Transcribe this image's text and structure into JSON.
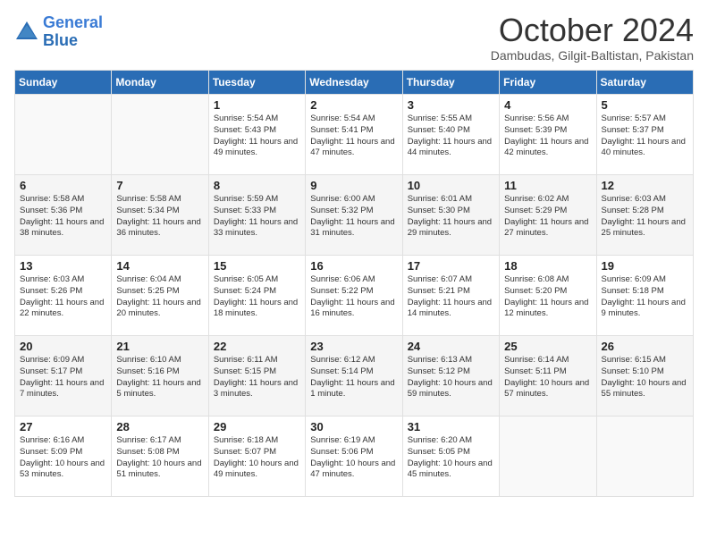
{
  "logo": {
    "line1": "General",
    "line2": "Blue"
  },
  "title": "October 2024",
  "location": "Dambudas, Gilgit-Baltistan, Pakistan",
  "days_of_week": [
    "Sunday",
    "Monday",
    "Tuesday",
    "Wednesday",
    "Thursday",
    "Friday",
    "Saturday"
  ],
  "weeks": [
    [
      {
        "day": null,
        "text": null
      },
      {
        "day": null,
        "text": null
      },
      {
        "day": "1",
        "text": "Sunrise: 5:54 AM\nSunset: 5:43 PM\nDaylight: 11 hours and 49 minutes."
      },
      {
        "day": "2",
        "text": "Sunrise: 5:54 AM\nSunset: 5:41 PM\nDaylight: 11 hours and 47 minutes."
      },
      {
        "day": "3",
        "text": "Sunrise: 5:55 AM\nSunset: 5:40 PM\nDaylight: 11 hours and 44 minutes."
      },
      {
        "day": "4",
        "text": "Sunrise: 5:56 AM\nSunset: 5:39 PM\nDaylight: 11 hours and 42 minutes."
      },
      {
        "day": "5",
        "text": "Sunrise: 5:57 AM\nSunset: 5:37 PM\nDaylight: 11 hours and 40 minutes."
      }
    ],
    [
      {
        "day": "6",
        "text": "Sunrise: 5:58 AM\nSunset: 5:36 PM\nDaylight: 11 hours and 38 minutes."
      },
      {
        "day": "7",
        "text": "Sunrise: 5:58 AM\nSunset: 5:34 PM\nDaylight: 11 hours and 36 minutes."
      },
      {
        "day": "8",
        "text": "Sunrise: 5:59 AM\nSunset: 5:33 PM\nDaylight: 11 hours and 33 minutes."
      },
      {
        "day": "9",
        "text": "Sunrise: 6:00 AM\nSunset: 5:32 PM\nDaylight: 11 hours and 31 minutes."
      },
      {
        "day": "10",
        "text": "Sunrise: 6:01 AM\nSunset: 5:30 PM\nDaylight: 11 hours and 29 minutes."
      },
      {
        "day": "11",
        "text": "Sunrise: 6:02 AM\nSunset: 5:29 PM\nDaylight: 11 hours and 27 minutes."
      },
      {
        "day": "12",
        "text": "Sunrise: 6:03 AM\nSunset: 5:28 PM\nDaylight: 11 hours and 25 minutes."
      }
    ],
    [
      {
        "day": "13",
        "text": "Sunrise: 6:03 AM\nSunset: 5:26 PM\nDaylight: 11 hours and 22 minutes."
      },
      {
        "day": "14",
        "text": "Sunrise: 6:04 AM\nSunset: 5:25 PM\nDaylight: 11 hours and 20 minutes."
      },
      {
        "day": "15",
        "text": "Sunrise: 6:05 AM\nSunset: 5:24 PM\nDaylight: 11 hours and 18 minutes."
      },
      {
        "day": "16",
        "text": "Sunrise: 6:06 AM\nSunset: 5:22 PM\nDaylight: 11 hours and 16 minutes."
      },
      {
        "day": "17",
        "text": "Sunrise: 6:07 AM\nSunset: 5:21 PM\nDaylight: 11 hours and 14 minutes."
      },
      {
        "day": "18",
        "text": "Sunrise: 6:08 AM\nSunset: 5:20 PM\nDaylight: 11 hours and 12 minutes."
      },
      {
        "day": "19",
        "text": "Sunrise: 6:09 AM\nSunset: 5:18 PM\nDaylight: 11 hours and 9 minutes."
      }
    ],
    [
      {
        "day": "20",
        "text": "Sunrise: 6:09 AM\nSunset: 5:17 PM\nDaylight: 11 hours and 7 minutes."
      },
      {
        "day": "21",
        "text": "Sunrise: 6:10 AM\nSunset: 5:16 PM\nDaylight: 11 hours and 5 minutes."
      },
      {
        "day": "22",
        "text": "Sunrise: 6:11 AM\nSunset: 5:15 PM\nDaylight: 11 hours and 3 minutes."
      },
      {
        "day": "23",
        "text": "Sunrise: 6:12 AM\nSunset: 5:14 PM\nDaylight: 11 hours and 1 minute."
      },
      {
        "day": "24",
        "text": "Sunrise: 6:13 AM\nSunset: 5:12 PM\nDaylight: 10 hours and 59 minutes."
      },
      {
        "day": "25",
        "text": "Sunrise: 6:14 AM\nSunset: 5:11 PM\nDaylight: 10 hours and 57 minutes."
      },
      {
        "day": "26",
        "text": "Sunrise: 6:15 AM\nSunset: 5:10 PM\nDaylight: 10 hours and 55 minutes."
      }
    ],
    [
      {
        "day": "27",
        "text": "Sunrise: 6:16 AM\nSunset: 5:09 PM\nDaylight: 10 hours and 53 minutes."
      },
      {
        "day": "28",
        "text": "Sunrise: 6:17 AM\nSunset: 5:08 PM\nDaylight: 10 hours and 51 minutes."
      },
      {
        "day": "29",
        "text": "Sunrise: 6:18 AM\nSunset: 5:07 PM\nDaylight: 10 hours and 49 minutes."
      },
      {
        "day": "30",
        "text": "Sunrise: 6:19 AM\nSunset: 5:06 PM\nDaylight: 10 hours and 47 minutes."
      },
      {
        "day": "31",
        "text": "Sunrise: 6:20 AM\nSunset: 5:05 PM\nDaylight: 10 hours and 45 minutes."
      },
      {
        "day": null,
        "text": null
      },
      {
        "day": null,
        "text": null
      }
    ]
  ]
}
